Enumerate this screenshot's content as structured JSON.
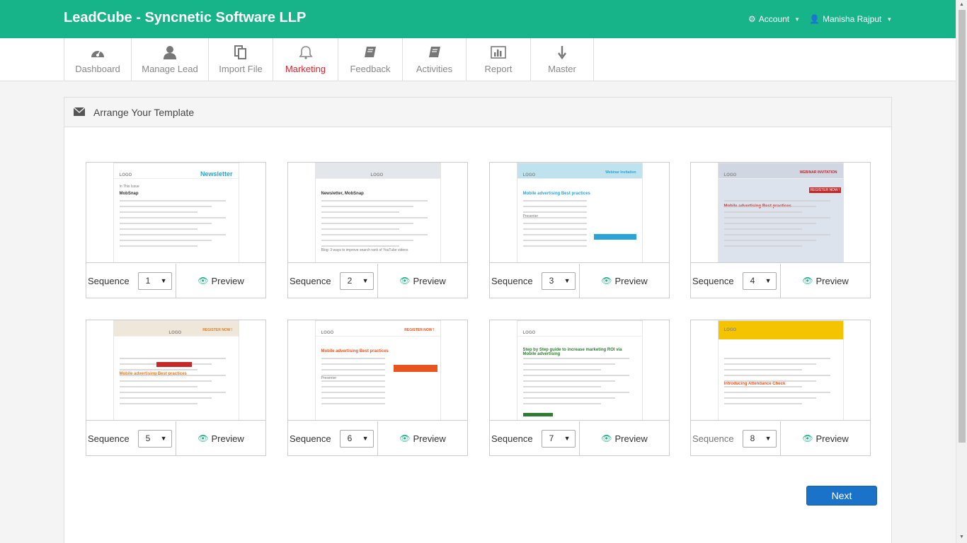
{
  "app": {
    "title": "LeadCube - Syncnetic Software LLP",
    "account_label": "Account",
    "user_label": "Manisha Rajput",
    "accent_color": "#17b389",
    "active_color": "#d9232d"
  },
  "nav": [
    {
      "label": "Dashboard",
      "icon": "dashboard-icon"
    },
    {
      "label": "Manage Lead",
      "icon": "user-icon"
    },
    {
      "label": "Import File",
      "icon": "files-icon"
    },
    {
      "label": "Marketing",
      "icon": "bell-icon",
      "active": true
    },
    {
      "label": "Feedback",
      "icon": "book-icon"
    },
    {
      "label": "Activities",
      "icon": "book-icon"
    },
    {
      "label": "Report",
      "icon": "bar-chart-icon"
    },
    {
      "label": "Master",
      "icon": "download-icon"
    }
  ],
  "panel": {
    "title": "Arrange Your Template",
    "icon": "envelope-icon"
  },
  "templates": [
    {
      "sequence_label": "Sequence",
      "sequence_value": "1",
      "preview_label": "Preview",
      "thumb": {
        "logo": "LOGO",
        "heading": "Newsletter",
        "title": "MobSnap",
        "subtitle": "In This Issue"
      }
    },
    {
      "sequence_label": "Sequence",
      "sequence_value": "2",
      "preview_label": "Preview",
      "thumb": {
        "logo": "LOGO",
        "heading": "",
        "title": "Newsletter, MobSnap",
        "subtitle": "Blog: 3 ways to improve search rank of YouTube videos"
      }
    },
    {
      "sequence_label": "Sequence",
      "sequence_value": "3",
      "preview_label": "Preview",
      "thumb": {
        "logo": "LOGO",
        "heading": "Webinar Invitation",
        "title": "Mobile advertising Best practices",
        "subtitle": "Presenter"
      }
    },
    {
      "sequence_label": "Sequence",
      "sequence_value": "4",
      "preview_label": "Preview",
      "thumb": {
        "logo": "LOGO",
        "heading": "WEBINAR INVITATION",
        "title": "Mobile advertising Best practices",
        "subtitle": "REGISTER NOW !"
      }
    },
    {
      "sequence_label": "Sequence",
      "sequence_value": "5",
      "preview_label": "Preview",
      "thumb": {
        "logo": "LOGO",
        "heading": "REGISTER NOW !",
        "title": "Mobile advertising Best practices",
        "subtitle": ""
      }
    },
    {
      "sequence_label": "Sequence",
      "sequence_value": "6",
      "preview_label": "Preview",
      "thumb": {
        "logo": "LOGO",
        "heading": "REGISTER NOW !",
        "title": "Mobile advertising Best practices",
        "subtitle": "Presenter"
      }
    },
    {
      "sequence_label": "Sequence",
      "sequence_value": "7",
      "preview_label": "Preview",
      "thumb": {
        "logo": "LOGO",
        "heading": "",
        "title": "Step by Step guide to increase marketing ROI via Mobile advertising",
        "subtitle": ""
      }
    },
    {
      "sequence_label": "Sequence",
      "sequence_value": "8",
      "preview_label": "Preview",
      "thumb": {
        "logo": "LOGO",
        "heading": "",
        "title": "Introducing Attendance Check",
        "subtitle": ""
      }
    }
  ],
  "next_button": {
    "label": "Next",
    "color": "#1a73c9"
  }
}
